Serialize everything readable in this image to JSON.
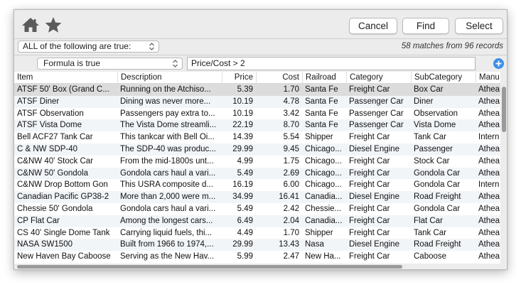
{
  "toolbar": {
    "home_icon": "home-icon",
    "star_icon": "star-icon",
    "cancel_label": "Cancel",
    "find_label": "Find",
    "select_label": "Select"
  },
  "criteria": {
    "match_mode": "ALL of the following are true:",
    "matches_text": "58 matches from 96 records",
    "condition_type": "Formula is true",
    "formula_value": "Price/Cost > 2"
  },
  "table": {
    "columns": [
      "Item",
      "Description",
      "Price",
      "Cost",
      "Railroad",
      "Category",
      "SubCategory",
      "Manu"
    ],
    "rows": [
      {
        "item": "ATSF 50' Box (Grand C...",
        "desc": "Running on the Atchiso...",
        "price": "5.39",
        "cost": "1.70",
        "rail": "Santa Fe",
        "cat": "Freight Car",
        "sub": "Box Car",
        "man": "Athea"
      },
      {
        "item": "ATSF Diner",
        "desc": "Dining was never more...",
        "price": "10.19",
        "cost": "4.78",
        "rail": "Santa Fe",
        "cat": "Passenger Car",
        "sub": "Diner",
        "man": "Athea"
      },
      {
        "item": "ATSF Observation",
        "desc": "Passengers pay extra to...",
        "price": "10.19",
        "cost": "3.42",
        "rail": "Santa Fe",
        "cat": "Passenger Car",
        "sub": "Observation",
        "man": "Athea"
      },
      {
        "item": "ATSF Vista Dome",
        "desc": "The Vista Dome streamli...",
        "price": "22.19",
        "cost": "8.70",
        "rail": "Santa Fe",
        "cat": "Passenger Car",
        "sub": "Vista Dome",
        "man": "Athea"
      },
      {
        "item": "Bell ACF27 Tank Car",
        "desc": "This tankcar with Bell Oi...",
        "price": "14.39",
        "cost": "5.54",
        "rail": "Shipper",
        "cat": "Freight Car",
        "sub": "Tank Car",
        "man": "Intern"
      },
      {
        "item": "C & NW SDP-40",
        "desc": "The SDP-40 was produc...",
        "price": "29.99",
        "cost": "9.45",
        "rail": "Chicago...",
        "cat": "Diesel Engine",
        "sub": "Passenger",
        "man": "Athea"
      },
      {
        "item": "C&NW 40' Stock Car",
        "desc": "From the mid-1800s unt...",
        "price": "4.99",
        "cost": "1.75",
        "rail": "Chicago...",
        "cat": "Freight Car",
        "sub": "Stock Car",
        "man": "Athea"
      },
      {
        "item": "C&NW 50' Gondola",
        "desc": "Gondola cars haul a vari...",
        "price": "5.49",
        "cost": "2.69",
        "rail": "Chicago...",
        "cat": "Freight Car",
        "sub": "Gondola Car",
        "man": "Athea"
      },
      {
        "item": "C&NW Drop Bottom Gon",
        "desc": "This USRA composite d...",
        "price": "16.19",
        "cost": "6.00",
        "rail": "Chicago...",
        "cat": "Freight Car",
        "sub": "Gondola Car",
        "man": "Intern"
      },
      {
        "item": "Canadian Pacific GP38-2",
        "desc": "More than 2,000 were m...",
        "price": "34.99",
        "cost": "16.41",
        "rail": "Canadia...",
        "cat": "Diesel Engine",
        "sub": "Road Freight",
        "man": "Athea"
      },
      {
        "item": "Chessie 50' Gondola",
        "desc": "Gondola cars haul a vari...",
        "price": "5.49",
        "cost": "2.42",
        "rail": "Chessie...",
        "cat": "Freight Car",
        "sub": "Gondola Car",
        "man": "Athea"
      },
      {
        "item": "CP Flat Car",
        "desc": "Among the longest cars...",
        "price": "6.49",
        "cost": "2.04",
        "rail": "Canadia...",
        "cat": "Freight Car",
        "sub": "Flat Car",
        "man": "Athea"
      },
      {
        "item": "CS 40' Single Dome Tank",
        "desc": "Carrying liquid fuels, thi...",
        "price": "4.49",
        "cost": "1.70",
        "rail": "Shipper",
        "cat": "Freight Car",
        "sub": "Tank Car",
        "man": "Athea"
      },
      {
        "item": "NASA SW1500",
        "desc": "Built from 1966 to 1974,...",
        "price": "29.99",
        "cost": "13.43",
        "rail": "Nasa",
        "cat": "Diesel Engine",
        "sub": "Road Freight",
        "man": "Athea"
      },
      {
        "item": "New Haven Bay Caboose",
        "desc": "Serving as the New Hav...",
        "price": "5.99",
        "cost": "2.47",
        "rail": "New Ha...",
        "cat": "Freight Car",
        "sub": "Caboose",
        "man": "Athea"
      }
    ]
  },
  "colors": {
    "accent": "#3d8ee6",
    "icon": "#5b5b5b",
    "selected_row": "#dcdcdc"
  }
}
